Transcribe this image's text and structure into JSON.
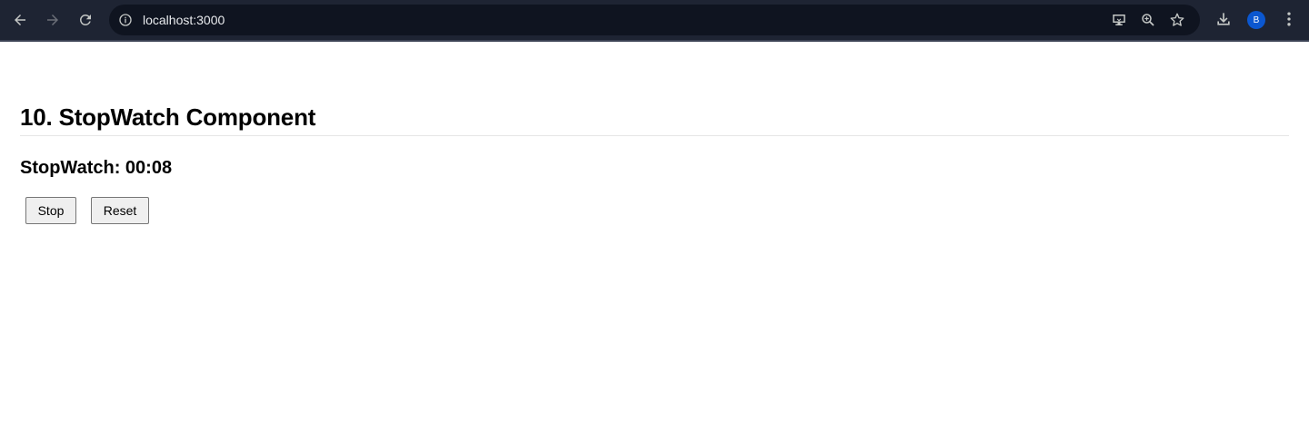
{
  "browser": {
    "url": "localhost:3000",
    "avatar_initial": "B",
    "icons": {
      "back": "arrow-left-icon",
      "forward": "arrow-right-icon",
      "reload": "reload-icon",
      "site_info": "info-icon",
      "install": "install-app-icon",
      "zoom": "zoom-icon",
      "bookmark": "star-icon",
      "downloads": "download-icon",
      "menu": "kebab-menu-icon"
    },
    "colors": {
      "toolbar": "#1e2433",
      "omnibox": "#0f1420",
      "avatar": "#0b57d0"
    }
  },
  "page": {
    "title": "10. StopWatch Component",
    "stopwatch_text": "StopWatch: 00:08",
    "buttons": {
      "stop_label": "Stop",
      "reset_label": "Reset"
    }
  }
}
